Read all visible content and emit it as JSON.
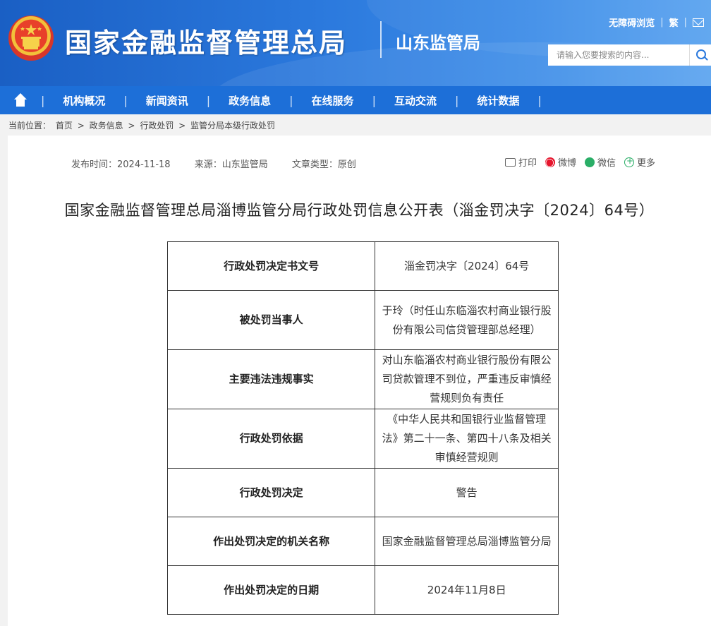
{
  "header": {
    "site_title": "国家金融监督管理总局",
    "sub_title": "山东监管局",
    "top_links": {
      "accessibility": "无障碍浏览",
      "traditional": "繁",
      "mail_icon": "mail-icon"
    },
    "search": {
      "placeholder": "请输入您要搜索的内容...",
      "icon": "search-icon"
    }
  },
  "nav": {
    "home_icon": "home-icon",
    "items": [
      "机构概况",
      "新闻资讯",
      "政务信息",
      "在线服务",
      "互动交流",
      "统计数据"
    ]
  },
  "breadcrumb": {
    "label": "当前位置：",
    "items": [
      "首页",
      "政务信息",
      "行政处罚",
      "监管分局本级行政处罚"
    ],
    "separator": ">"
  },
  "article": {
    "publish_time": "发布时间：2024-11-18",
    "source": "来源：山东监管局",
    "type": "文章类型：原创",
    "share": {
      "print": "打印",
      "weibo": "微博",
      "wechat": "微信",
      "more": "更多"
    },
    "title": "国家金融监督管理总局淄博监管分局行政处罚信息公开表（淄金罚决字〔2024〕64号）",
    "table": [
      {
        "key": "行政处罚决定书文号",
        "value": "淄金罚决字〔2024〕64号"
      },
      {
        "key": "被处罚当事人",
        "value": "于玲（时任山东临淄农村商业银行股份有限公司信贷管理部总经理）"
      },
      {
        "key": "主要违法违规事实",
        "value": "对山东临淄农村商业银行股份有限公司贷款管理不到位，严重违反审慎经营规则负有责任"
      },
      {
        "key": "行政处罚依据",
        "value": "《中华人民共和国银行业监督管理法》第二十一条、第四十八条及相关审慎经营规则"
      },
      {
        "key": "行政处罚决定",
        "value": "警告"
      },
      {
        "key": "作出处罚决定的机关名称",
        "value": "国家金融监督管理总局淄博监管分局"
      },
      {
        "key": "作出处罚决定的日期",
        "value": "2024年11月8日"
      }
    ]
  }
}
